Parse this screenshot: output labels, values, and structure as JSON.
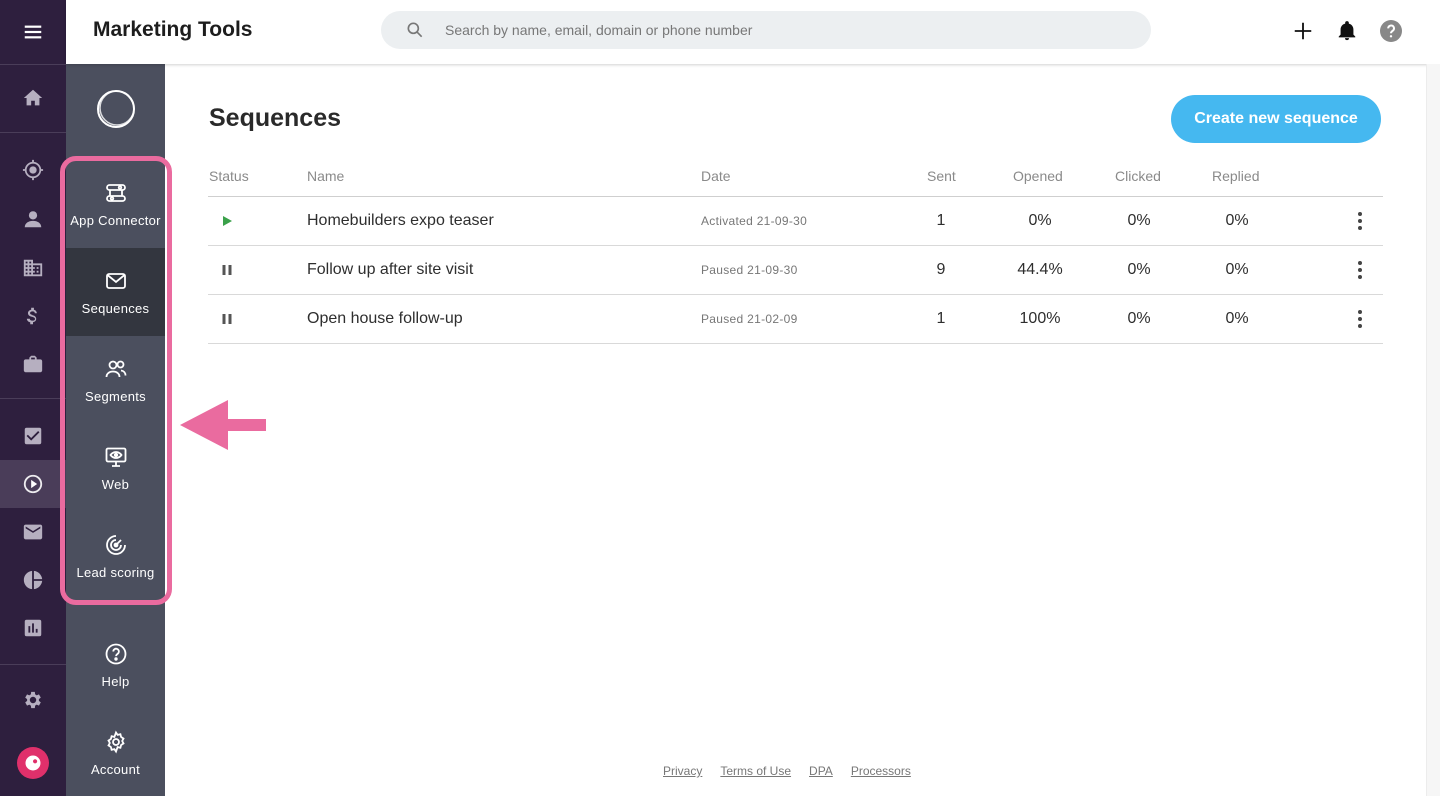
{
  "header": {
    "title": "Marketing Tools",
    "search_placeholder": "Search by name, email, domain or phone number"
  },
  "rail": {
    "items": [
      "menu-icon",
      "home-icon",
      "target-icon",
      "person-icon",
      "building-icon",
      "dollar-icon",
      "briefcase-icon",
      "checkbox-icon",
      "sequences-play-icon",
      "mail-icon",
      "pie-chart-icon",
      "bar-chart-icon",
      "gear-icon",
      "capsule-logo"
    ],
    "active": "sequences-play-icon"
  },
  "subnav": {
    "items": [
      {
        "label": "App Connector",
        "icon": "connector-icon"
      },
      {
        "label": "Sequences",
        "icon": "envelope-icon",
        "active": true
      },
      {
        "label": "Segments",
        "icon": "people-icon"
      },
      {
        "label": "Web",
        "icon": "monitor-eye-icon"
      },
      {
        "label": "Lead scoring",
        "icon": "target-icon"
      },
      {
        "label": "Help",
        "icon": "help-icon"
      },
      {
        "label": "Account",
        "icon": "gear-icon"
      }
    ]
  },
  "main": {
    "title": "Sequences",
    "create_button": "Create new sequence",
    "columns": [
      "Status",
      "Name",
      "Date",
      "Sent",
      "Opened",
      "Clicked",
      "Replied"
    ],
    "rows": [
      {
        "status": "active",
        "name": "Homebuilders expo teaser",
        "date": "Activated 21-09-30",
        "sent": "1",
        "opened": "0%",
        "clicked": "0%",
        "replied": "0%"
      },
      {
        "status": "paused",
        "name": "Follow up after site visit",
        "date": "Paused 21-09-30",
        "sent": "9",
        "opened": "44.4%",
        "clicked": "0%",
        "replied": "0%"
      },
      {
        "status": "paused",
        "name": "Open house follow-up",
        "date": "Paused 21-02-09",
        "sent": "1",
        "opened": "100%",
        "clicked": "0%",
        "replied": "0%"
      }
    ]
  },
  "footer": {
    "links": [
      "Privacy",
      "Terms of Use",
      "DPA",
      "Processors"
    ]
  },
  "colors": {
    "rail_bg": "#2e1f3e",
    "subnav_bg": "#4b4f5e",
    "accent": "#45b8f0",
    "highlight": "#ea6b9f",
    "active_green": "#3aa14a",
    "logo": "#e0306b"
  }
}
